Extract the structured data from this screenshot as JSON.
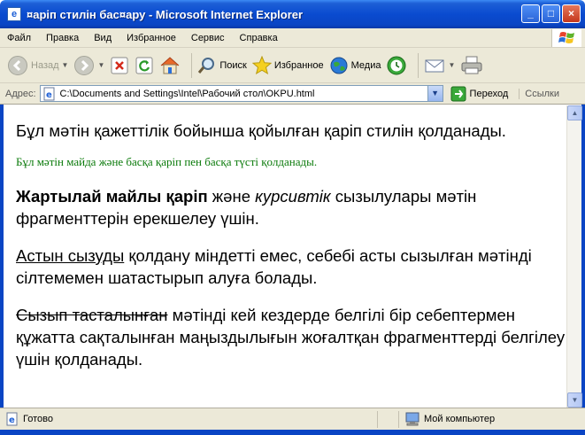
{
  "window": {
    "title": "¤аріп стилін бас¤ару - Microsoft Internet Explorer",
    "app_icon": "ie-document-icon",
    "controls": {
      "minimize": "_",
      "maximize": "□",
      "close": "×"
    }
  },
  "menubar": {
    "items": [
      "Файл",
      "Правка",
      "Вид",
      "Избранное",
      "Сервис",
      "Справка"
    ]
  },
  "toolbar": {
    "back_label": "Назад",
    "search_label": "Поиск",
    "favorites_label": "Избранное",
    "media_label": "Медиа"
  },
  "address": {
    "label": "Адрес:",
    "value": "C:\\Documents and Settings\\Intel\\Рабочий стол\\OKPU.html",
    "go_label": "Переход",
    "links_label": "Ссылки"
  },
  "content": {
    "p1": "Бұл мәтін қажеттілік бойынша қойылған қаріп стилін қолданады.",
    "p2": "Бұл мәтін майда және басқа қаріп пен басқа түсті қолданады.",
    "p3_bold": "Жартылай майлы қаріп",
    "p3_mid": " және ",
    "p3_italic": "курсивтік",
    "p3_rest": " сызылулары мәтін фрагменттерін ерекшелеу үшін.",
    "p4_underline": "Астын сызуды",
    "p4_rest": " қолдану міндетті емес, себебі асты сызылған мәтінді сілтемемен шатастырып алуға болады.",
    "p5_strike": "Сызып тасталынған",
    "p5_rest": " мәтінді кей кездерде белгілі бір себептермен құжатта сақталынған маңыздылығын жоғалтқан фрагменттерді белгілеу үшін қолданады."
  },
  "status": {
    "left": "Готово",
    "zone": "Мой компьютер"
  },
  "colors": {
    "green_text": "#0a7a0a",
    "titlebar_blue": "#0a4bd0"
  }
}
